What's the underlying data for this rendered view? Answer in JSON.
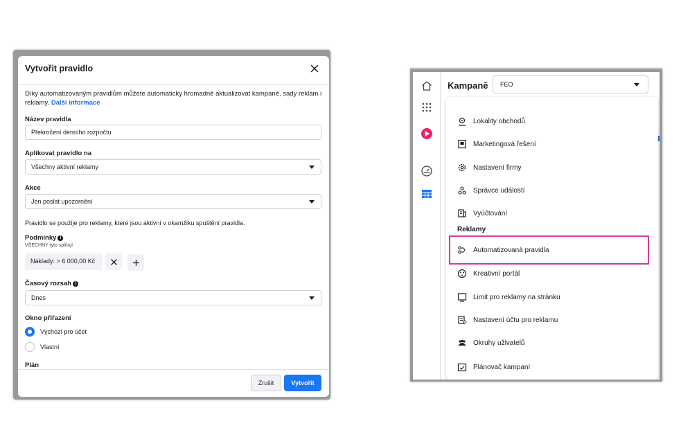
{
  "dialog": {
    "title": "Vytvořit pravidlo",
    "intro_text": "Díky automatizovaným pravidlům můžete automaticky hromadně aktualizovat kampaně, sady reklam i reklamy.",
    "intro_link": "Další informace",
    "rule_name_label": "Název pravidla",
    "rule_name_value": "Překročení denního rozpočtu",
    "apply_to_label": "Aplikovat pravidlo na",
    "apply_to_value": "Všechny aktivní reklamy",
    "action_label": "Akce",
    "action_value": "Jen poslat upozornění",
    "apply_note": "Pravidlo se použije pro reklamy, které jsou aktivní v okamžiku spuštění pravidla.",
    "conditions_label": "Podmínky",
    "conditions_sub": "VŠECHNY tyto splňují",
    "condition_chip": "Náklady:  >  6 000,00 Kč",
    "time_range_label": "Časový rozsah",
    "time_range_value": "Dnes",
    "attribution_label": "Okno přiřazení",
    "attribution_options": [
      "Výchozí pro účet",
      "Vlastní"
    ],
    "attribution_selected": 0,
    "schedule_label": "Plán",
    "cancel_label": "Zrušit",
    "create_label": "Vytvořit"
  },
  "panel": {
    "title": "Kampaně",
    "account_value": "FEO",
    "menu_items": [
      {
        "label": "Lokality obchodů",
        "icon": "store-location-icon"
      },
      {
        "label": "Marketingová řešení",
        "icon": "marketing-solutions-icon"
      },
      {
        "label": "Nastavení firmy",
        "icon": "gear-icon"
      },
      {
        "label": "Správce událostí",
        "icon": "events-manager-icon"
      },
      {
        "label": "Vyúčtování",
        "icon": "billing-icon"
      }
    ],
    "section_label": "Reklamy",
    "ads_items": [
      {
        "label": "Automatizovaná pravidla",
        "icon": "automated-rules-icon"
      },
      {
        "label": "Kreativní portál",
        "icon": "creative-hub-icon"
      },
      {
        "label": "Limit pro reklamy na stránku",
        "icon": "page-limit-icon"
      },
      {
        "label": "Nastavení účtu pro reklamu",
        "icon": "ad-account-settings-icon"
      },
      {
        "label": "Okruhy uživatelů",
        "icon": "audiences-icon"
      },
      {
        "label": "Plánovač kampaní",
        "icon": "campaign-planner-icon"
      }
    ],
    "highlighted_item": "Automatizovaná pravidla",
    "highlight_color": "#d63a9b"
  },
  "colors": {
    "primary": "#1877f2",
    "highlight": "#d63a9b"
  }
}
